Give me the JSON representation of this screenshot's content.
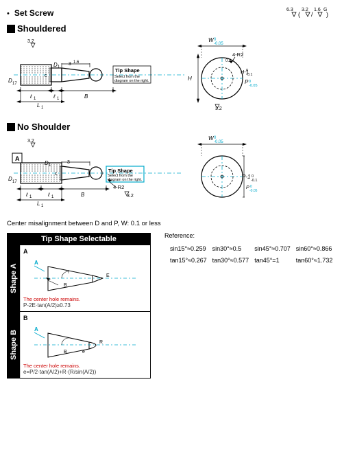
{
  "header": {
    "set_screw_label": "Set Screw",
    "tip_icons_label": "6.3  (  3.2 / 1.6  )"
  },
  "shouldered": {
    "title": "Shouldered"
  },
  "no_shoulder": {
    "title": "No Shoulder"
  },
  "misalignment_note": "Center misalignment between D and P, W: 0.1 or less",
  "tip_shape_table": {
    "title": "Tip Shape Selectable",
    "rows": [
      {
        "shape_label": "Shape A",
        "sub_label": "A",
        "note_red": "The center hole remains.",
        "note_formula": "P-2E·tan(A/2)≥0.73"
      },
      {
        "shape_label": "Shape B",
        "sub_label": "B",
        "note_red": "The center hole remains.",
        "note_formula": "e=P/2·tan(A/2)+R·(R/sin(A/2))"
      }
    ]
  },
  "reference": {
    "title": "Reference:",
    "values": [
      {
        "label": "sin15°≈0.259",
        "label2": "sin30°≈0.5",
        "label3": "sin45°≈0.707",
        "label4": "sin60°≈0.866"
      },
      {
        "label": "tan15°≈0.267",
        "label2": "tan30°≈0.577",
        "label3": "tan45°=1",
        "label4": "tan60°≈1.732"
      }
    ]
  },
  "labels": {
    "tip_shape": "Tip Shape",
    "select_note": "Select from the diagram on the right.",
    "dimensions": {
      "d17": "D17",
      "d1": "D1",
      "l1": "ℓ1",
      "l1b": "ℓ1",
      "L1": "L1",
      "B": "B",
      "r3_2": "3.2",
      "four_r2": "4-R2",
      "W": "W",
      "H": "H",
      "P": "P",
      "G": "G",
      "A": "A"
    }
  }
}
